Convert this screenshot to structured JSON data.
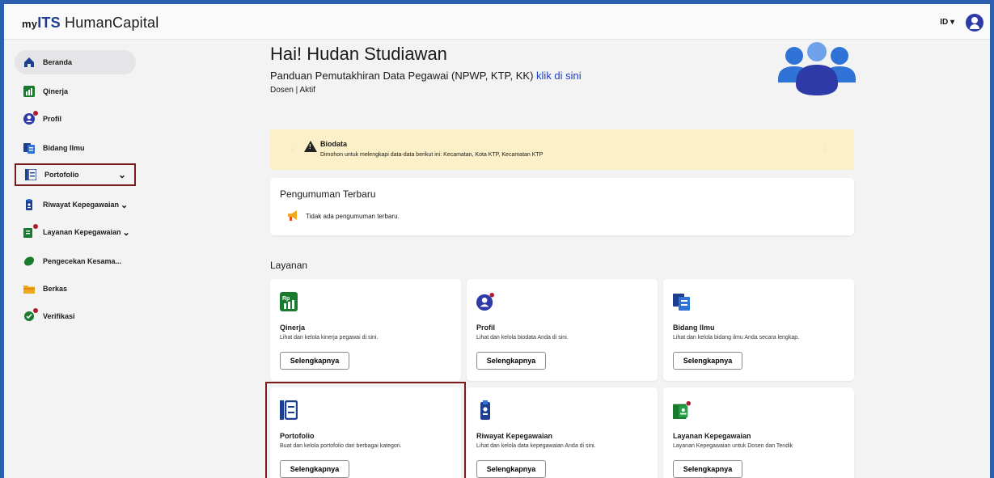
{
  "header": {
    "logo_prefix": "my",
    "logo_its": "ITS",
    "logo_suffix": " HumanCapital",
    "language": "ID ▾"
  },
  "sidebar": {
    "items": [
      {
        "label": "Beranda",
        "icon": "home-icon"
      },
      {
        "label": "Qinerja",
        "icon": "qinerja-icon"
      },
      {
        "label": "Profil",
        "icon": "profile-icon"
      },
      {
        "label": "Bidang Ilmu",
        "icon": "bidang-ilmu-icon"
      },
      {
        "label": "Portofolio",
        "icon": "portfolio-icon"
      },
      {
        "label": "Riwayat Kepegawaian",
        "icon": "badge-icon"
      },
      {
        "label": "Layanan Kepegawaian",
        "icon": "layanan-icon"
      },
      {
        "label": "Pengecekan Kesama...",
        "icon": "leaf-icon"
      },
      {
        "label": "Berkas",
        "icon": "folder-icon"
      },
      {
        "label": "Verifikasi",
        "icon": "verification-icon"
      }
    ]
  },
  "main": {
    "greeting": "Hai! Hudan Studiawan",
    "guide_text": "Panduan Pemutakhiran Data Pegawai (NPWP, KTP, KK)",
    "guide_link": "klik di sini",
    "status": "Dosen | Aktif"
  },
  "alert": {
    "title": "Biodata",
    "message": "Dimohon untuk melengkapi data-data berikut ini: Kecamatan, Kota KTP, Kecamatan KTP"
  },
  "announcement": {
    "title": "Pengumuman Terbaru",
    "empty": "Tidak ada pengumuman terbaru."
  },
  "services": {
    "title": "Layanan",
    "button_label": "Selengkapnya",
    "items": [
      {
        "name": "Qinerja",
        "desc": "Lihat dan kelola kinerja pegawai di sini."
      },
      {
        "name": "Profil",
        "desc": "Lihat dan kelola biodata Anda di sini."
      },
      {
        "name": "Bidang Ilmu",
        "desc": "Lihat dan kelola bidang ilmu Anda secara lengkap."
      },
      {
        "name": "Portofolio",
        "desc": "Buat dan kelola portofolio dari berbagai kategori."
      },
      {
        "name": "Riwayat Kepegawaian",
        "desc": "Lihat dan kelola data kepegawaian Anda di sini."
      },
      {
        "name": "Layanan Kepegawaian",
        "desc": "Layanan Kepegawaian untuk Dosen dan Tendik"
      }
    ]
  },
  "colors": {
    "brand": "#1e3f8f",
    "accent_blue": "#2d3aa7",
    "highlight": "#7a1c1c",
    "alert_bg": "#fcf0c8",
    "green": "#1a7a2e"
  }
}
